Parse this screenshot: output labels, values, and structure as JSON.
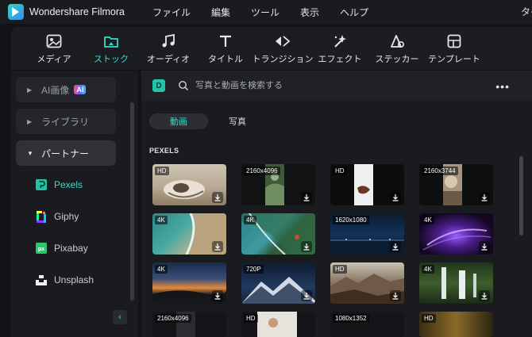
{
  "titlebar": {
    "app_title": "Wondershare Filmora",
    "menu": [
      "ファイル",
      "編集",
      "ツール",
      "表示",
      "ヘルプ"
    ],
    "right_text": "タイ"
  },
  "toolbar": {
    "items": [
      {
        "label": "メディア",
        "icon": "media-icon"
      },
      {
        "label": "ストック",
        "icon": "stock-icon",
        "active": true
      },
      {
        "label": "オーディオ",
        "icon": "audio-icon"
      },
      {
        "label": "タイトル",
        "icon": "title-icon"
      },
      {
        "label": "トランジション",
        "icon": "transition-icon"
      },
      {
        "label": "エフェクト",
        "icon": "effect-icon"
      },
      {
        "label": "ステッカー",
        "icon": "sticker-icon"
      },
      {
        "label": "テンプレート",
        "icon": "template-icon"
      }
    ]
  },
  "sidebar": {
    "ai_image": "AI画像",
    "ai_badge": "AI",
    "library": "ライブラリ",
    "partner": "パートナー",
    "partners": [
      "Pexels",
      "Giphy",
      "Pixabay",
      "Unsplash"
    ],
    "collapse_glyph": "‹"
  },
  "search": {
    "provider_badge": "D",
    "placeholder": "写真と動画を検索する",
    "more_glyph": "•••"
  },
  "tabs": [
    "動画",
    "写真"
  ],
  "section_title": "PEXELS",
  "thumbnails": [
    {
      "badge": "HD"
    },
    {
      "badge": "2160x4096"
    },
    {
      "badge": "HD"
    },
    {
      "badge": "2160x3744"
    },
    {
      "badge": "4K"
    },
    {
      "badge": "4K"
    },
    {
      "badge": "1620x1080"
    },
    {
      "badge": "4K"
    },
    {
      "badge": "4K"
    },
    {
      "badge": "720P"
    },
    {
      "badge": "HD"
    },
    {
      "badge": "4K"
    },
    {
      "badge": "2160x4096"
    },
    {
      "badge": "HD"
    },
    {
      "badge": "1080x1352"
    },
    {
      "badge": "HD"
    }
  ],
  "colors": {
    "accent": "#2fe0cb",
    "background": "#121316",
    "panel": "#1a1b1f"
  }
}
